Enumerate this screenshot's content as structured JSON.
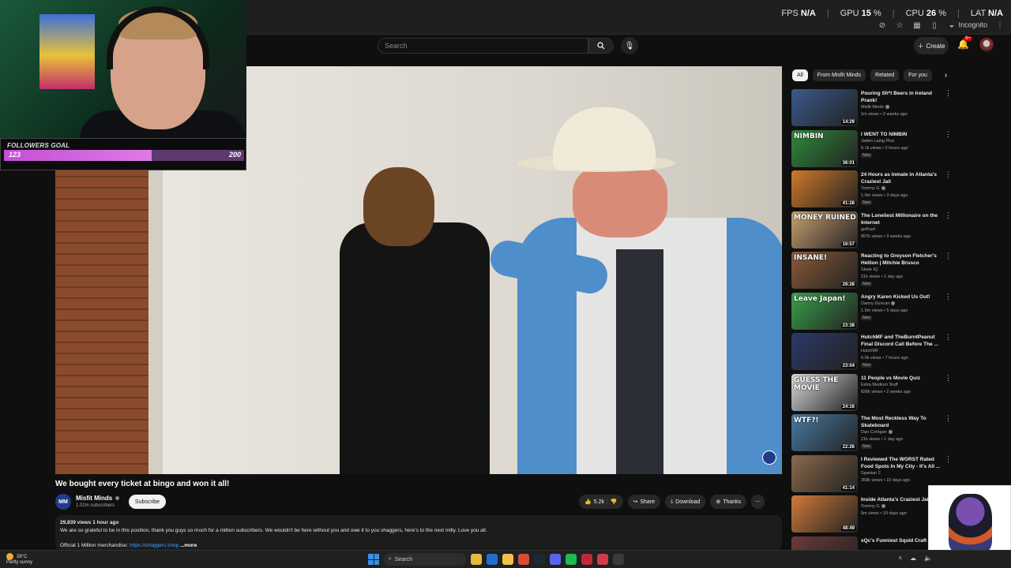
{
  "perf": {
    "fps_label": "FPS",
    "fps_value": "N/A",
    "gpu_label": "GPU",
    "gpu_value": "15",
    "cpu_label": "CPU",
    "cpu_value": "26",
    "lat_label": "LAT",
    "lat_value": "N/A",
    "percent_sign": "%"
  },
  "browser": {
    "incognito_label": "Incognito"
  },
  "header": {
    "search_placeholder": "Search",
    "create_label": "Create",
    "notifications_badge": "9+"
  },
  "overlay": {
    "followers_goal_label": "FOLLOWERS GOAL",
    "followers_current": "123",
    "followers_target": "200",
    "followers_progress": 0.615
  },
  "video": {
    "title": "We bought every ticket at bingo and won it all!",
    "channel_name": "Misfit Minds",
    "channel_avatar": "MM",
    "subscribers": "1.02m subscribers",
    "subscribe_label": "Subscribe",
    "likes": "5.2k",
    "share_label": "Share",
    "download_label": "Download",
    "thanks_label": "Thanks",
    "views_line": "29,839 views  1 hour ago",
    "description": "We are so grateful to be in this position, thank you guys so much for a million subscribers. We wouldn't be here without you and owe it to you shaggers, here's to the next milly. Love you all.",
    "merch_label": "Official 1 Million merchandise:",
    "merch_link": "https://shaggers.shop",
    "more_label": "...more"
  },
  "chips": [
    "All",
    "From Misfit Minds",
    "Related",
    "For you"
  ],
  "recommendations": [
    {
      "title": "Pouring Sh*t Beers in Ireland Prank!",
      "channel": "Misfit Minds",
      "verified": true,
      "meta": "1m views • 2 weeks ago",
      "new": "",
      "duration": "14:29",
      "thumb_text": "",
      "thumb_color": "#3b5a8a"
    },
    {
      "title": "I WENT TO NIMBIN",
      "channel": "Jaden Laing Plus",
      "verified": false,
      "meta": "5.1k views • 2 hours ago",
      "new": "New",
      "duration": "36:01",
      "thumb_text": "NIMBIN",
      "thumb_color": "#2f8a3a"
    },
    {
      "title": "24 Hours as Inmate in Atlanta's Craziest Jail",
      "channel": "Tommy G",
      "verified": true,
      "meta": "1.9m views • 3 days ago",
      "new": "New",
      "duration": "41:28",
      "thumb_text": "",
      "thumb_color": "#d07a2a"
    },
    {
      "title": "The Loneliest Millionaire on the Internet",
      "channel": "golfcart",
      "verified": false,
      "meta": "807k views • 3 weeks ago",
      "new": "",
      "duration": "16:57",
      "thumb_text": "MONEY RUINED",
      "thumb_color": "#c9a070"
    },
    {
      "title": "Reacting to Greyson Fletcher's Hellion | Mitchie Brusco",
      "channel": "Skate IQ",
      "verified": false,
      "meta": "21k views • 1 day ago",
      "new": "New",
      "duration": "28:28",
      "thumb_text": "INSANE!",
      "thumb_color": "#8a5a3a"
    },
    {
      "title": "Angry Karen Kicked Us Out!",
      "channel": "Danny Duncan",
      "verified": true,
      "meta": "1.5m views • 5 days ago",
      "new": "New",
      "duration": "23:38",
      "thumb_text": "Leave Japan!",
      "thumb_color": "#3aa04a"
    },
    {
      "title": "HutchMF and TheBurntPeanut Final Discord Call Before The ...",
      "channel": "HutchMF",
      "verified": false,
      "meta": "5.9k views • 7 hours ago",
      "new": "New",
      "duration": "23:04",
      "thumb_text": "",
      "thumb_color": "#2a3a6a"
    },
    {
      "title": "11 People vs Movie Quiz",
      "channel": "Extra Medium Stuff",
      "verified": false,
      "meta": "826k views • 2 weeks ago",
      "new": "",
      "duration": "24:16",
      "thumb_text": "GUESS THE MOVIE",
      "thumb_color": "#d8d8d8"
    },
    {
      "title": "The Most Reckless Way To Skateboard",
      "channel": "Dan Corrigan",
      "verified": true,
      "meta": "21k views • 1 day ago",
      "new": "New",
      "duration": "22:26",
      "thumb_text": "WTF?!",
      "thumb_color": "#4a7aa0"
    },
    {
      "title": "I Reviewed The WORST Rated Food Spots In My City - It's All ...",
      "channel": "Spanian 2",
      "verified": false,
      "meta": "358k views • 10 days ago",
      "new": "",
      "duration": "41:14",
      "thumb_text": "",
      "thumb_color": "#8a6a4a"
    },
    {
      "title": "Inside Atlanta's Craziest Jail",
      "channel": "Tommy G",
      "verified": true,
      "meta": "5m views • 10 days ago",
      "new": "",
      "duration": "48:49",
      "thumb_text": "",
      "thumb_color": "#d07a3a"
    },
    {
      "title": "xQc's Funniest Squid Craft",
      "channel": "",
      "verified": false,
      "meta": "",
      "new": "",
      "duration": "",
      "thumb_text": "",
      "thumb_color": "#6a3a3a"
    }
  ],
  "taskbar": {
    "temperature": "28°C",
    "weather": "Partly sunny",
    "search_label": "Search",
    "apps": [
      {
        "name": "file-explorer",
        "color": "#e8b83a"
      },
      {
        "name": "outlook",
        "color": "#1f6fd0"
      },
      {
        "name": "folder",
        "color": "#f0c04a"
      },
      {
        "name": "chrome",
        "color": "#d84a3a"
      },
      {
        "name": "steam",
        "color": "#1b2838"
      },
      {
        "name": "discord",
        "color": "#5865f2"
      },
      {
        "name": "spotify",
        "color": "#1db954"
      },
      {
        "name": "app-red",
        "color": "#c0283a"
      },
      {
        "name": "app-rose",
        "color": "#d03a4a"
      },
      {
        "name": "obs",
        "color": "#3a3a3a"
      }
    ]
  }
}
